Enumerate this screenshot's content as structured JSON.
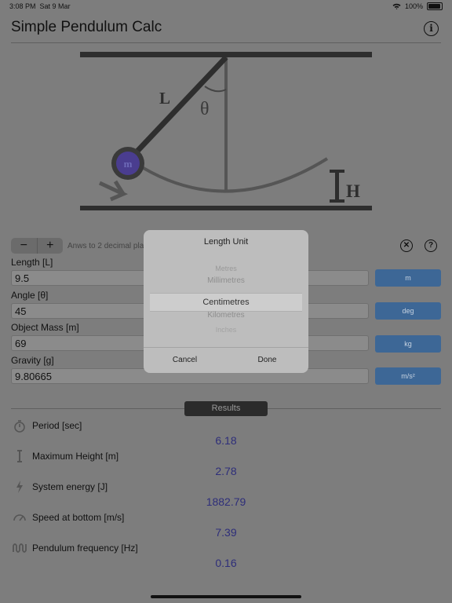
{
  "status": {
    "time": "3:08 PM",
    "date": "Sat 9 Mar",
    "battery": "100%"
  },
  "header": {
    "title": "Simple Pendulum Calc",
    "info_label": "i"
  },
  "diagram": {
    "length_label": "L",
    "angle_label": "θ",
    "mass_label": "m",
    "height_label": "H"
  },
  "controls": {
    "minus": "−",
    "plus": "+",
    "hint": "Anws to 2 decimal pla",
    "clear_label": "✕",
    "help_label": "?"
  },
  "inputs": [
    {
      "label": "Length [L]",
      "value": "9.5",
      "unit": "m"
    },
    {
      "label": "Angle [θ]",
      "value": "45",
      "unit": "deg"
    },
    {
      "label": "Object Mass [m]",
      "value": "69",
      "unit": "kg"
    },
    {
      "label": "Gravity [g]",
      "value": "9.80665",
      "unit": "m/s²"
    }
  ],
  "results": {
    "tab_label": "Results",
    "items": [
      {
        "label": "Period [sec]",
        "value": "6.18",
        "icon": "stopwatch-icon"
      },
      {
        "label": "Maximum Height [m]",
        "value": "2.78",
        "icon": "height-icon"
      },
      {
        "label": "System energy [J]",
        "value": "1882.79",
        "icon": "bolt-icon"
      },
      {
        "label": "Speed at bottom [m/s]",
        "value": "7.39",
        "icon": "speedometer-icon"
      },
      {
        "label": "Pendulum frequency [Hz]",
        "value": "0.16",
        "icon": "wave-icon"
      }
    ]
  },
  "dialog": {
    "title": "Length Unit",
    "options": [
      "Metres",
      "Millimetres",
      "Centimetres",
      "Kilometres",
      "Inches"
    ],
    "selected": "Centimetres",
    "cancel": "Cancel",
    "done": "Done"
  }
}
